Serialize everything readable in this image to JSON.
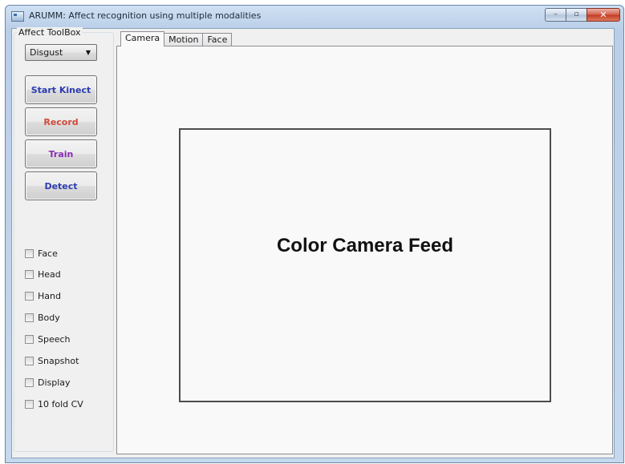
{
  "window": {
    "title": "ARUMM: Affect recognition using multiple modalities",
    "controls": {
      "minimize": "–",
      "maximize": "▫",
      "close": "✕"
    }
  },
  "toolbox": {
    "header": "Affect ToolBox",
    "emotion_select": {
      "selected": "Disgust"
    },
    "buttons": {
      "start_kinect": {
        "label": "Start Kinect",
        "color": "#2c3cb0"
      },
      "record": {
        "label": "Record",
        "color": "#d04a3a"
      },
      "train": {
        "label": "Train",
        "color": "#8a2cb0"
      },
      "detect": {
        "label": "Detect",
        "color": "#2c3cb0"
      }
    },
    "checkboxes": [
      {
        "label": "Face",
        "checked": false
      },
      {
        "label": "Head",
        "checked": false
      },
      {
        "label": "Hand",
        "checked": false
      },
      {
        "label": "Body",
        "checked": false
      },
      {
        "label": "Speech",
        "checked": false
      },
      {
        "label": "Snapshot",
        "checked": false
      },
      {
        "label": "Display",
        "checked": false
      },
      {
        "label": "10 fold CV",
        "checked": false
      }
    ]
  },
  "tabs": [
    {
      "label": "Camera",
      "active": true
    },
    {
      "label": "Motion",
      "active": false
    },
    {
      "label": "Face",
      "active": false
    }
  ],
  "camera_panel": {
    "feed_label": "Color Camera Feed"
  }
}
